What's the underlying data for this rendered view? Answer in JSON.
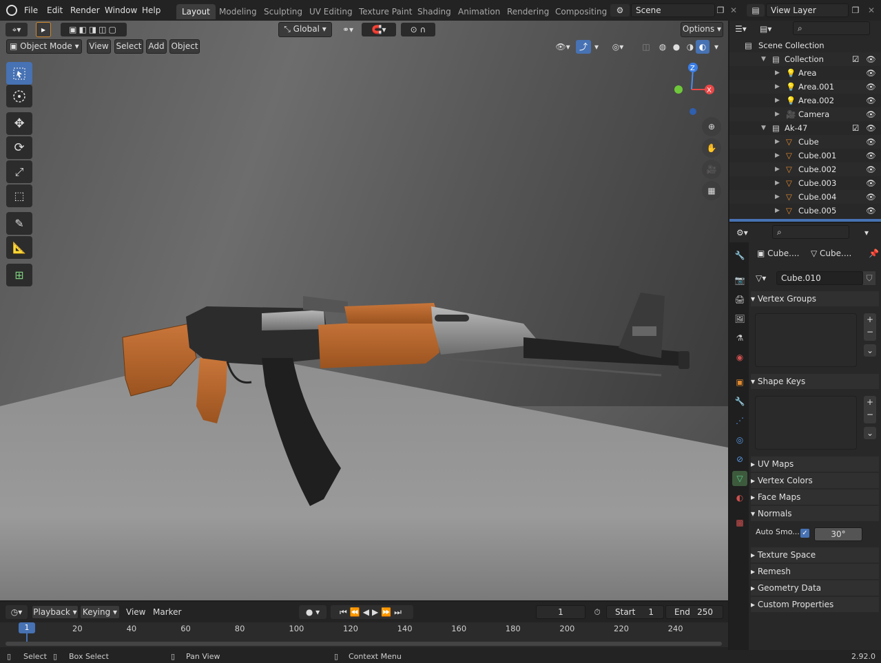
{
  "topbar": {
    "menus": [
      "File",
      "Edit",
      "Render",
      "Window",
      "Help"
    ],
    "workspaces": [
      "Layout",
      "Modeling",
      "Sculpting",
      "UV Editing",
      "Texture Paint",
      "Shading",
      "Animation",
      "Rendering",
      "Compositing"
    ],
    "scene_label": "Scene",
    "view_layer_label": "View Layer"
  },
  "viewport_header": {
    "transform_orientation": "Global",
    "options_label": "Options",
    "mode": "Object Mode",
    "menus": [
      "View",
      "Select",
      "Add",
      "Object"
    ]
  },
  "gizmo": {
    "z": "Z",
    "x": "X"
  },
  "outliner": {
    "search_placeholder": "",
    "rows": [
      {
        "label": "Scene Collection",
        "icon": "scene-collection-icon"
      },
      {
        "label": "Collection",
        "icon": "collection-icon"
      },
      {
        "label": "Area",
        "icon": "light-icon"
      },
      {
        "label": "Area.001",
        "icon": "light-icon"
      },
      {
        "label": "Area.002",
        "icon": "light-icon"
      },
      {
        "label": "Camera",
        "icon": "camera-icon"
      },
      {
        "label": "Ak-47",
        "icon": "collection-icon"
      },
      {
        "label": "Cube",
        "icon": "mesh-icon"
      },
      {
        "label": "Cube.001",
        "icon": "mesh-icon"
      },
      {
        "label": "Cube.002",
        "icon": "mesh-icon"
      },
      {
        "label": "Cube.003",
        "icon": "mesh-icon"
      },
      {
        "label": "Cube.004",
        "icon": "mesh-icon"
      },
      {
        "label": "Cube.005",
        "icon": "mesh-icon"
      }
    ]
  },
  "properties": {
    "breadcrumb_object": "Cube....",
    "breadcrumb_mesh": "Cube....",
    "mesh_name": "Cube.010",
    "panels": {
      "vertex_groups": "Vertex Groups",
      "shape_keys": "Shape Keys",
      "uv_maps": "UV Maps",
      "vertex_colors": "Vertex Colors",
      "face_maps": "Face Maps",
      "normals": "Normals",
      "auto_smooth_label": "Auto Smo...",
      "auto_smooth_angle": "30°",
      "texture_space": "Texture Space",
      "remesh": "Remesh",
      "geometry_data": "Geometry Data",
      "custom_properties": "Custom Properties"
    }
  },
  "timeline": {
    "menus": [
      "Playback",
      "Keying",
      "View",
      "Marker"
    ],
    "current_frame": "1",
    "start_label": "Start",
    "start_value": "1",
    "end_label": "End",
    "end_value": "250",
    "ticks": [
      "20",
      "40",
      "60",
      "80",
      "100",
      "120",
      "140",
      "160",
      "180",
      "200",
      "220",
      "240"
    ],
    "playhead": "1"
  },
  "statusbar": {
    "select": "Select",
    "box_select": "Box Select",
    "pan_view": "Pan View",
    "context_menu": "Context Menu",
    "version": "2.92.0"
  },
  "colors": {
    "accent": "#4772b3",
    "wood": "#b9662a",
    "metal_dark": "#2a2a2a"
  }
}
